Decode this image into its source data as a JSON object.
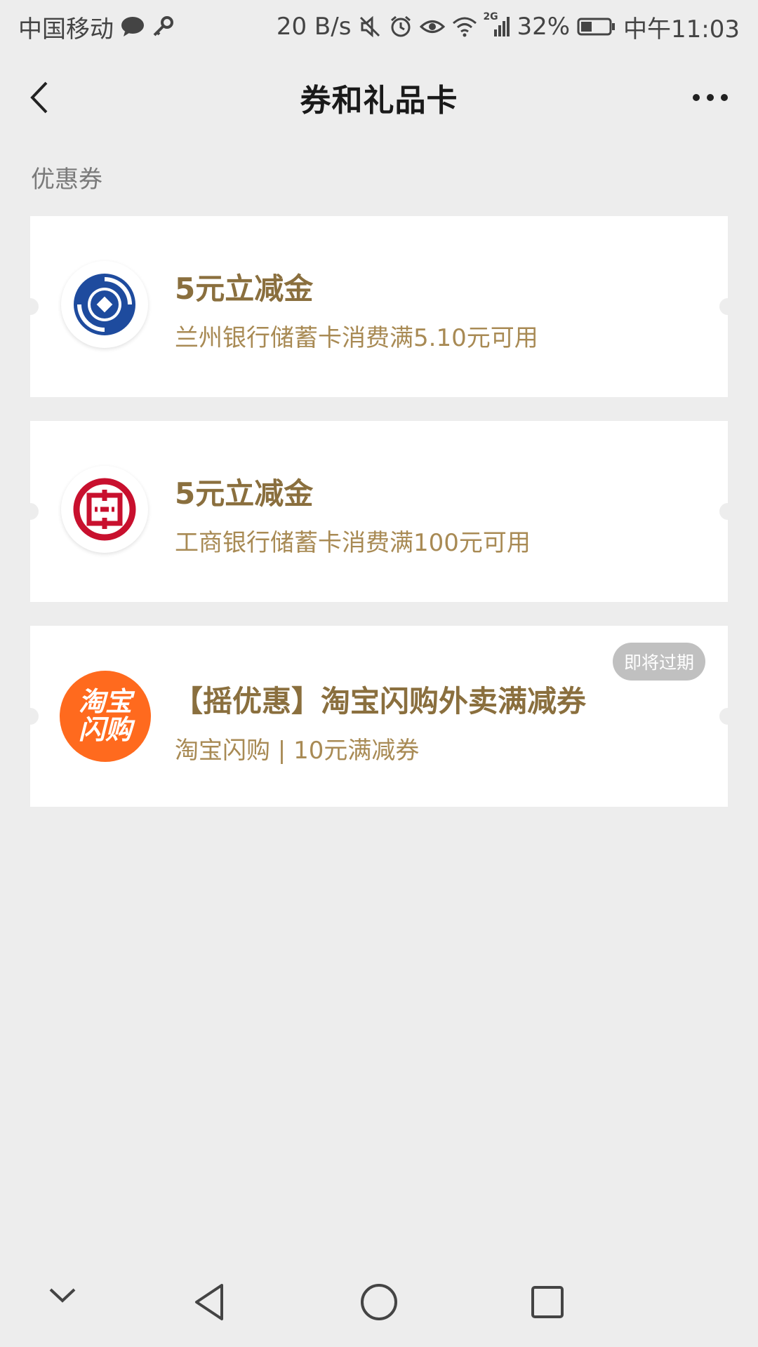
{
  "status_bar": {
    "carrier": "中国移动",
    "net_speed": "20 B/s",
    "signal_label": "2G",
    "battery": "32%",
    "time": "中午11:03"
  },
  "nav": {
    "title": "券和礼品卡"
  },
  "section_title": "优惠券",
  "coupons": [
    {
      "title": "5元立减金",
      "subtitle": "兰州银行储蓄卡消费满5.10元可用",
      "logo": "lanzhou-bank-logo"
    },
    {
      "title": "5元立减金",
      "subtitle": "工商银行储蓄卡消费满100元可用",
      "logo": "icbc-logo"
    },
    {
      "title": "【摇优惠】淘宝闪购外卖满减券",
      "subtitle": "淘宝闪购 | 10元满减券",
      "logo": "taobao-shangou-logo",
      "logo_text_line1": "淘宝",
      "logo_text_line2": "闪购",
      "badge": "即将过期"
    }
  ],
  "colors": {
    "background": "#ededed",
    "coupon_title": "#8a6f3e",
    "coupon_subtitle": "#a88a54",
    "taobao_orange": "#ff6a1e",
    "icbc_red": "#c8102e",
    "lanzhou_blue": "#1e4b9e"
  }
}
